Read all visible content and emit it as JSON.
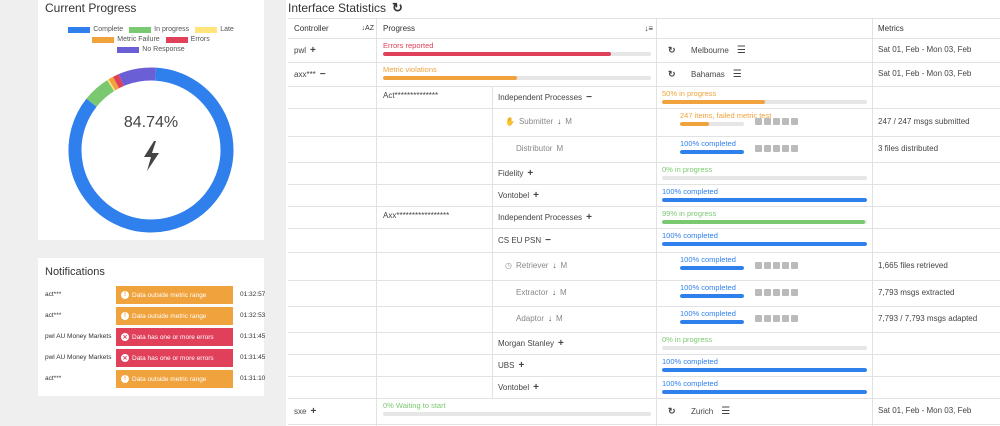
{
  "progress_card": {
    "title": "Current Progress",
    "center_value": "84.74%",
    "legend": [
      {
        "label": "Complete",
        "color": "#2f80ed"
      },
      {
        "label": "In progress",
        "color": "#7ac86f"
      },
      {
        "label": "Late",
        "color": "#ffe57a"
      },
      {
        "label": "Metric Failure",
        "color": "#f0a23c"
      },
      {
        "label": "Errors",
        "color": "#e0405a"
      },
      {
        "label": "No Response",
        "color": "#6b5fd6"
      }
    ],
    "segments": [
      {
        "label": "Complete",
        "value": 84.74
      },
      {
        "label": "In progress",
        "value": 5.4
      },
      {
        "label": "Late",
        "value": 0.3
      },
      {
        "label": "Metric Failure",
        "value": 1.0
      },
      {
        "label": "Errors",
        "value": 1.2
      },
      {
        "label": "No Response",
        "value": 7.36
      }
    ]
  },
  "notifications": {
    "title": "Notifications",
    "items": [
      {
        "name": "act***",
        "message": "Data outside metric range",
        "type": "warning",
        "time": "01:32:57"
      },
      {
        "name": "act***",
        "message": "Data outside metric range",
        "type": "warning",
        "time": "01:32:53"
      },
      {
        "name": "pwl AU Money Markets",
        "message": "Data has one or more errors",
        "type": "error",
        "time": "01:31:45"
      },
      {
        "name": "pwl AU Money Markets",
        "message": "Data has one or more errors",
        "type": "error",
        "time": "01:31:45"
      },
      {
        "name": "act***",
        "message": "Data outside metric range",
        "type": "warning",
        "time": "01:31:10"
      }
    ]
  },
  "main": {
    "title": "Interface Statistics",
    "headers": {
      "controller": "Controller",
      "progress": "Progress",
      "metrics": "Metrics"
    },
    "rows": [
      {
        "controller": "pwl",
        "ctrl_action": "+",
        "bar_text": "Errors reported",
        "bar_color": "#e0405a",
        "bar_value": 0.85,
        "location": "Melbourne",
        "metrics": "Sat 01, Feb - Mon 03, Feb"
      },
      {
        "controller": "axx***",
        "ctrl_action": "−",
        "bar_text": "Metric violations",
        "bar_color": "#f0a23c",
        "bar_value": 0.5,
        "location": "Bahamas",
        "metrics": "Sat 01, Feb - Mon 03, Feb"
      },
      {
        "sub1": "Act**************",
        "sub2": "Independent Processes",
        "sub2_action": "−",
        "bar_text": "50% in progress",
        "bar_color": "#f0a23c",
        "bar_value": 0.5
      },
      {
        "sub3": "Submitter",
        "sub3_mode": "M",
        "bar_text": "247 items, failed metric test",
        "bar_color": "#f0a23c",
        "bar_value": 0.45,
        "metrics": "247 / 247 msgs submitted"
      },
      {
        "sub3": "Distributor",
        "sub3_mode": "M",
        "bar_text": "100% completed",
        "bar_color": "#2f80ed",
        "bar_value": 1,
        "metrics": "3 files distributed"
      },
      {
        "sub2": "Fidelity",
        "sub2_action": "+",
        "bar_text": "0% in progress",
        "bar_color": "#7ac86f",
        "bar_value": 0
      },
      {
        "sub2": "Vontobel",
        "sub2_action": "+",
        "bar_text": "100% completed",
        "bar_color": "#2f80ed",
        "bar_value": 1
      },
      {
        "sub1": "Axx*****************",
        "sub2": "Independent Processes",
        "sub2_action": "+",
        "bar_text": "99% in progress",
        "bar_color": "#7ac86f",
        "bar_value": 0.99
      },
      {
        "sub2": "CS EU PSN",
        "sub2_action": "−",
        "bar_text": "100% completed",
        "bar_color": "#2f80ed",
        "bar_value": 1
      },
      {
        "sub3": "Retriever",
        "sub3_mode": "M",
        "bar_text": "100% completed",
        "bar_color": "#2f80ed",
        "bar_value": 1,
        "metrics": "1,665 files retrieved"
      },
      {
        "sub3": "Extractor",
        "sub3_mode": "M",
        "bar_text": "100% completed",
        "bar_color": "#2f80ed",
        "bar_value": 1,
        "metrics": "7,793 msgs extracted"
      },
      {
        "sub3": "Adaptor",
        "sub3_mode": "M",
        "bar_text": "100% completed",
        "bar_color": "#2f80ed",
        "bar_value": 1,
        "metrics": "7,793 / 7,793 msgs adapted"
      },
      {
        "sub2": "Morgan Stanley",
        "sub2_action": "+",
        "bar_text": "0% in progress",
        "bar_color": "#7ac86f",
        "bar_value": 0
      },
      {
        "sub2": "UBS",
        "sub2_action": "+",
        "bar_text": "100% completed",
        "bar_color": "#2f80ed",
        "bar_value": 1
      },
      {
        "sub2": "Vontobel",
        "sub2_action": "+",
        "bar_text": "100% completed",
        "bar_color": "#2f80ed",
        "bar_value": 1
      },
      {
        "controller": "sxe",
        "ctrl_action": "+",
        "bar_text": "0% Waiting to start",
        "bar_color": "#7ac86f",
        "bar_value": 0,
        "location": "Zurich",
        "metrics": "Sat 01, Feb - Mon 03, Feb"
      }
    ]
  }
}
